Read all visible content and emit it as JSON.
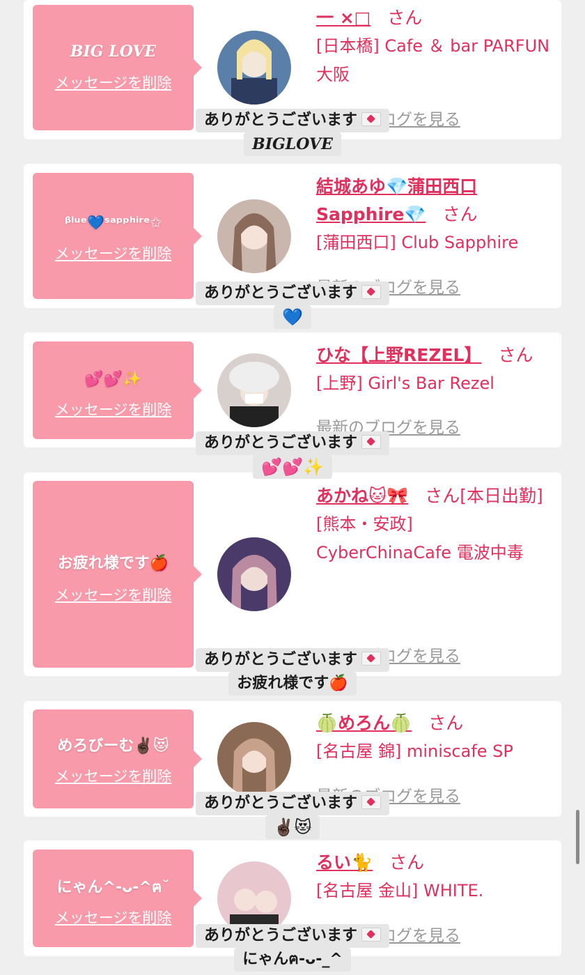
{
  "common": {
    "delete_label": "メッセージを削除",
    "san": "さん",
    "blog_link": "最新のブログを見る",
    "thanks": "ありがとうございます"
  },
  "cards": [
    {
      "bubble": "BIG LOVE",
      "name": "一 ×□",
      "shop": "[日本橋] Cafe ＆ bar PARFUN 大阪",
      "reply": "BIGLOVE"
    },
    {
      "bubble": "ᵝˡᵘᵉ💙ˢᵃᵖᵖʰⁱʳᵉ✩",
      "name": "結城あゆ💎蒲田西口Sapphire💎",
      "shop": "[蒲田西口] Club Sapphire",
      "reply": "💙"
    },
    {
      "bubble": "💕💕✨",
      "name": "ひな【上野REZEL】",
      "shop": "[上野] Girl's Bar Rezel",
      "reply": "💕💕✨"
    },
    {
      "bubble": "お疲れ様です🍎",
      "name": "あかね🐱🎀",
      "shop": "[熊本・安政] CyberChinaCafe 電波中毒",
      "name_suffix": "[本日出勤]",
      "reply": "お疲れ様です🍎"
    },
    {
      "bubble": "めろびーむ✌🏿😻",
      "name": "🍈めろん🍈",
      "shop": "[名古屋 錦] miniscafe SP",
      "reply": "✌🏿😻"
    },
    {
      "bubble": "にゃん^-ᴗ-^ฅ˘",
      "name": "るい🐈",
      "shop": "[名古屋 金山] WHITE.",
      "reply": "にゃんฅ-ᴗ-_^"
    }
  ],
  "colors": {
    "background": "#efefef",
    "card": "#ffffff",
    "bubble": "#f99aab",
    "accent": "#e0305d",
    "link_gray": "#9a9a9a",
    "thanks_bg": "#e6e6e6"
  }
}
